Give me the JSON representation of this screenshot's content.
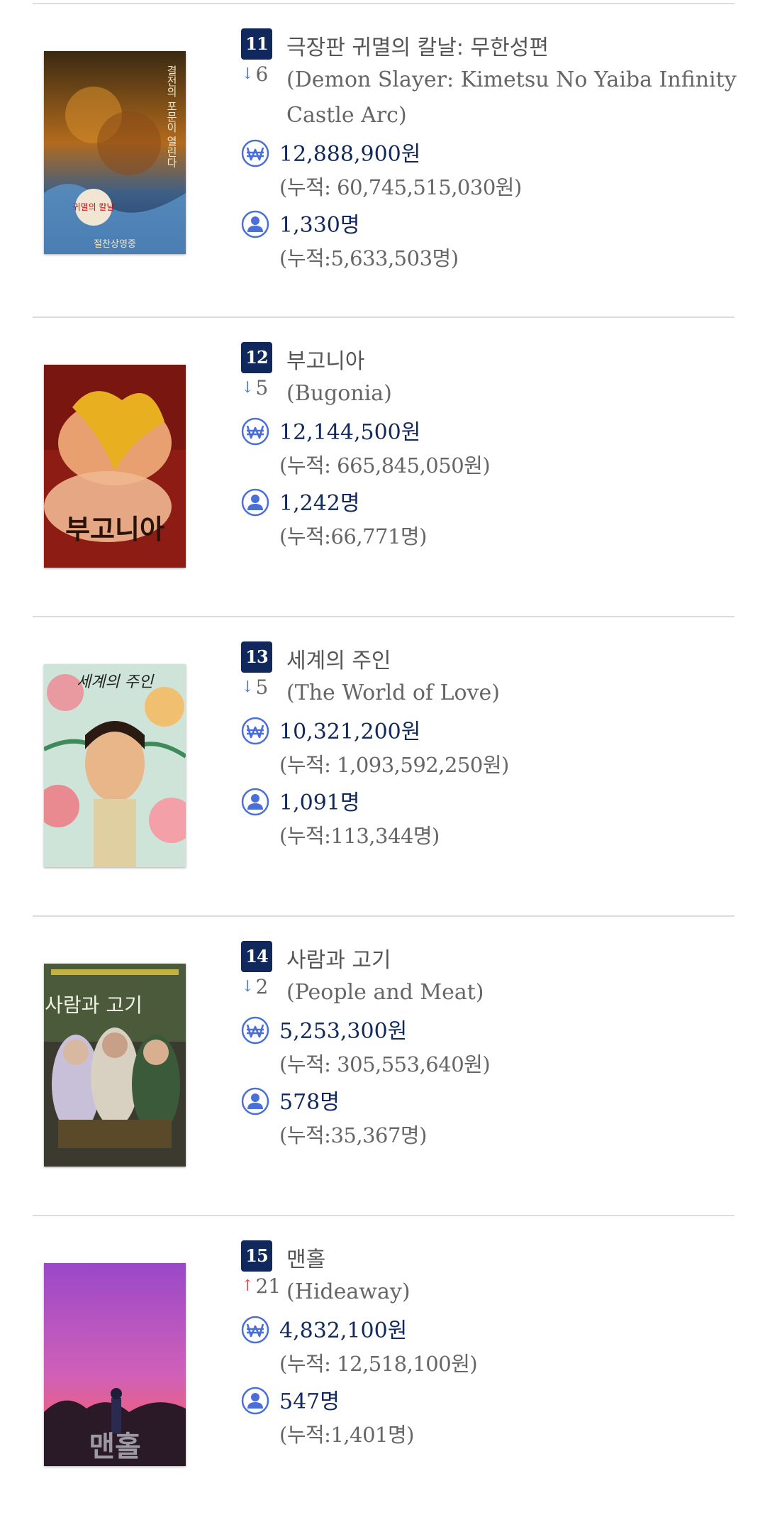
{
  "entries": [
    {
      "rank": "11",
      "title_kr": "극장판 귀멸의 칼날: 무한성편",
      "change_dir": "down",
      "change": "6",
      "title_en": "(Demon Slayer: Kimetsu No Yaiba Infinity Castle Arc)",
      "sales": "12,888,900원",
      "sales_acc": "(누적: 60,745,515,030원)",
      "audience": "1,330명",
      "audience_acc": "(누적:5,633,503명)",
      "poster_text": "귀멸의 칼날",
      "poster_tagline": "결전의 포문이 열린다",
      "poster_footer": "절찬상영중"
    },
    {
      "rank": "12",
      "title_kr": "부고니아",
      "change_dir": "down",
      "change": "5",
      "title_en": "(Bugonia)",
      "sales": "12,144,500원",
      "sales_acc": "(누적: 665,845,050원)",
      "audience": "1,242명",
      "audience_acc": "(누적:66,771명)",
      "poster_text": "부고니아"
    },
    {
      "rank": "13",
      "title_kr": "세계의 주인",
      "change_dir": "down",
      "change": "5",
      "title_en": "(The World of Love)",
      "sales": "10,321,200원",
      "sales_acc": "(누적: 1,093,592,250원)",
      "audience": "1,091명",
      "audience_acc": "(누적:113,344명)",
      "poster_text": "세계의 주인"
    },
    {
      "rank": "14",
      "title_kr": "사람과 고기",
      "change_dir": "down",
      "change": "2",
      "title_en": "(People and Meat)",
      "sales": "5,253,300원",
      "sales_acc": "(누적: 305,553,640원)",
      "audience": "578명",
      "audience_acc": "(누적:35,367명)",
      "poster_text": "사람과 고기"
    },
    {
      "rank": "15",
      "title_kr": "맨홀",
      "change_dir": "up",
      "change": "21",
      "title_en": "(Hideaway)",
      "sales": "4,832,100원",
      "sales_acc": "(누적: 12,518,100원)",
      "audience": "547명",
      "audience_acc": "(누적:1,401명)",
      "poster_text": "맨홀"
    }
  ],
  "icons": {
    "sales": "won-coin-icon",
    "audience": "person-icon",
    "down": "arrow-down-icon",
    "up": "arrow-up-icon"
  },
  "colors": {
    "badge": "#10285c",
    "value": "#10285c",
    "icon": "#4a6fd8",
    "down": "#4a7fe0",
    "up": "#e84a3c"
  }
}
